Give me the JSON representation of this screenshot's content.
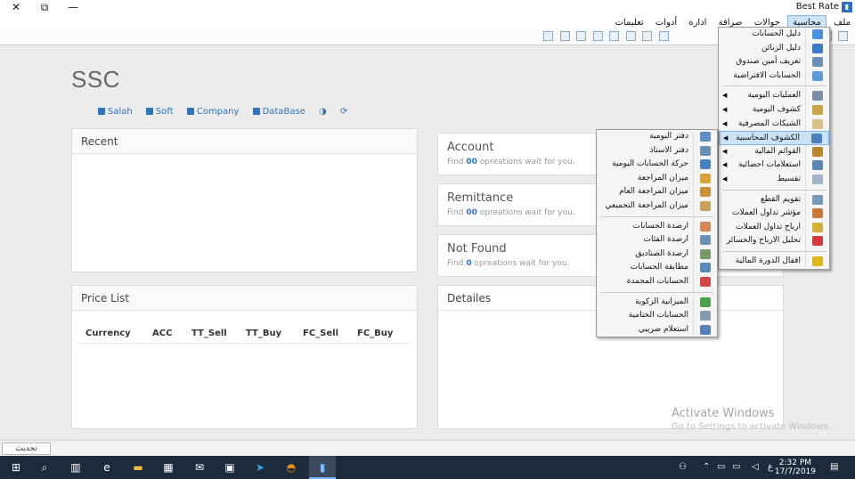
{
  "window": {
    "title": "Best Rate",
    "controls": {
      "close": "✕",
      "restore": "⧉",
      "minimize": "—"
    }
  },
  "menubar": {
    "items": [
      {
        "label": "ملف",
        "active": false
      },
      {
        "label": "محاسبة",
        "active": true
      },
      {
        "label": "حوالات",
        "active": false
      },
      {
        "label": "صرافة",
        "active": false
      },
      {
        "label": "ادارة",
        "active": false
      },
      {
        "label": "أدوات",
        "active": false
      },
      {
        "label": "تعليمات",
        "active": false
      }
    ]
  },
  "header": {
    "brand": "SSC",
    "info": {
      "user": "Salah",
      "soft": "Soft",
      "company": "Company",
      "database": "DataBase"
    }
  },
  "panels": {
    "recent": {
      "title": "Recent"
    },
    "price_list": {
      "title": "Price List",
      "columns": [
        "Currency",
        "ACC",
        "TT_Sell",
        "TT_Buy",
        "FC_Sell",
        "FC_Buy"
      ]
    },
    "details": {
      "title": "Detailes"
    }
  },
  "cards": [
    {
      "title": "Account",
      "prefix": "Find",
      "count": "00",
      "suffix": "opreations wait for you."
    },
    {
      "title": "Remittance",
      "prefix": "Find",
      "count": "00",
      "suffix": "opreations wait for you."
    },
    {
      "title": "Not Found",
      "prefix": "Find",
      "count": "0",
      "suffix": "opreations wait for you."
    }
  ],
  "watermark": {
    "title": "Activate Windows",
    "subtitle": "Go to Settings to activate Windows."
  },
  "status": {
    "refresh_label": "تحديث"
  },
  "taskbar": {
    "time": "2:32 PM",
    "date": "17/7/2019",
    "lang": "ع"
  },
  "accounting_menu": {
    "items": [
      {
        "label": "دليل الحسابات",
        "icon_color": "#4a90d9",
        "arrow": false
      },
      {
        "label": "دليل الزبائن",
        "icon_color": "#3b7bc4",
        "arrow": false
      },
      {
        "label": "تعريف أمين صندوق",
        "icon_color": "#6c8fb5",
        "arrow": false
      },
      {
        "label": "الحسابات الافتراضية",
        "icon_color": "#5d9bd5",
        "arrow": false,
        "sep_after": true
      },
      {
        "label": "العمليات اليومية",
        "icon_color": "#7a8fa6",
        "arrow": true
      },
      {
        "label": "كشوف اليومية",
        "icon_color": "#c9a64b",
        "arrow": true
      },
      {
        "label": "الشيكات المصرفية",
        "icon_color": "#d8c18a",
        "arrow": true
      },
      {
        "label": "الكشوف المحاسبية",
        "icon_color": "#4a7fb8",
        "arrow": true,
        "highlight": true
      },
      {
        "label": "القوائم المالية",
        "icon_color": "#b8862c",
        "arrow": true
      },
      {
        "label": "استعلامات احصائية",
        "icon_color": "#5b86b3",
        "arrow": true
      },
      {
        "label": "تقسيط",
        "icon_color": "#9fb4c9",
        "arrow": true,
        "sep_after": true
      },
      {
        "label": "تقويم القطع",
        "icon_color": "#7a98b8",
        "arrow": false
      },
      {
        "label": "مؤشر تداول العملات",
        "icon_color": "#c97a3b",
        "arrow": false
      },
      {
        "label": "ارباح تداول العملات",
        "icon_color": "#d2b13a",
        "arrow": false
      },
      {
        "label": "تحليل الارباح والخسائر",
        "icon_color": "#d23b3b",
        "arrow": false,
        "sep_after": true
      },
      {
        "label": "اقفال الدورة المالية",
        "icon_color": "#e0b520",
        "arrow": false
      }
    ]
  },
  "reports_submenu": {
    "items": [
      {
        "label": "دفتر اليومية",
        "icon_color": "#5a8ec5"
      },
      {
        "label": "دفتر الاستاذ",
        "icon_color": "#6a8fb0"
      },
      {
        "label": "حركة الحسابات اليومية",
        "icon_color": "#4a82bf"
      },
      {
        "label": "ميزان المراجعة",
        "icon_color": "#d6a43a"
      },
      {
        "label": "ميزان المراجعة العام",
        "icon_color": "#c98f3a"
      },
      {
        "label": "ميزان المراجعة التجميعي",
        "icon_color": "#c7a05a",
        "sep_after": true
      },
      {
        "label": "ارصدة الحسابات",
        "icon_color": "#d0885a"
      },
      {
        "label": "ارصدة الفئات",
        "icon_color": "#6b8fb5"
      },
      {
        "label": "ارصدة الصناديق",
        "icon_color": "#7a9a6a"
      },
      {
        "label": "مطابقة الحسابات",
        "icon_color": "#5a8ab5"
      },
      {
        "label": "الحسابات المجمدة",
        "icon_color": "#d24a4a",
        "sep_after": true
      },
      {
        "label": "الميزانية الزكوية",
        "icon_color": "#4aa34a"
      },
      {
        "label": "الحسابات الختامية",
        "icon_color": "#8a9ab0"
      },
      {
        "label": "استعلام ضريبي",
        "icon_color": "#5a7fb5"
      }
    ]
  }
}
